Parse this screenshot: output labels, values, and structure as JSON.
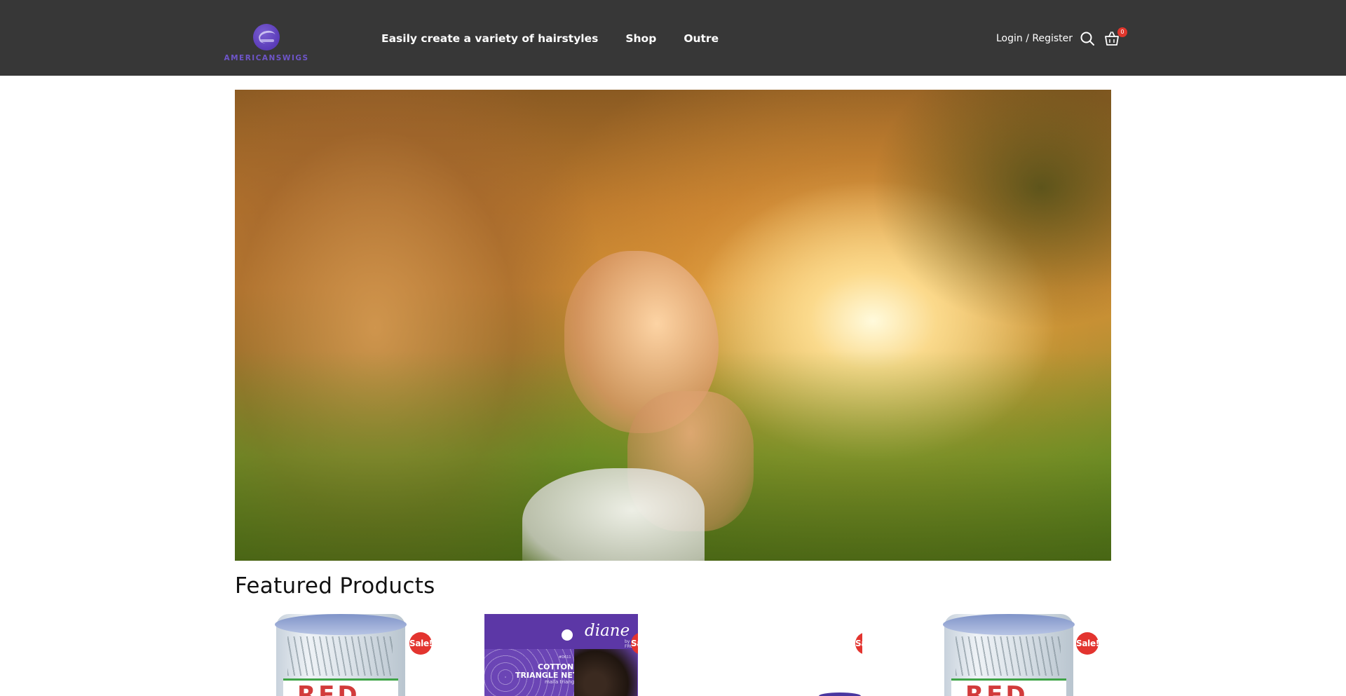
{
  "header": {
    "logo_text": "AMERICANSWIGS",
    "nav": [
      "Easily create a variety of hairstyles",
      "Shop",
      "Outre"
    ],
    "login_label": "Login / Register",
    "cart_count": "0",
    "icons": [
      "search-icon",
      "cart-icon"
    ]
  },
  "featured": {
    "title": "Featured Products",
    "sale_label": "Sale!",
    "products": [
      {
        "brand_text": "RED"
      },
      {
        "brand_text": "diane",
        "brand_sub": "by FROMM",
        "item_no": "#D611",
        "line1": "COTTON",
        "line2": "TRIANGLE NET",
        "line3": "malla triangular"
      },
      {},
      {
        "brand_text": "RED"
      }
    ]
  },
  "colors": {
    "header_bg": "#373737",
    "brand_purple": "#6e55c9",
    "sale_red": "#e3342f"
  }
}
